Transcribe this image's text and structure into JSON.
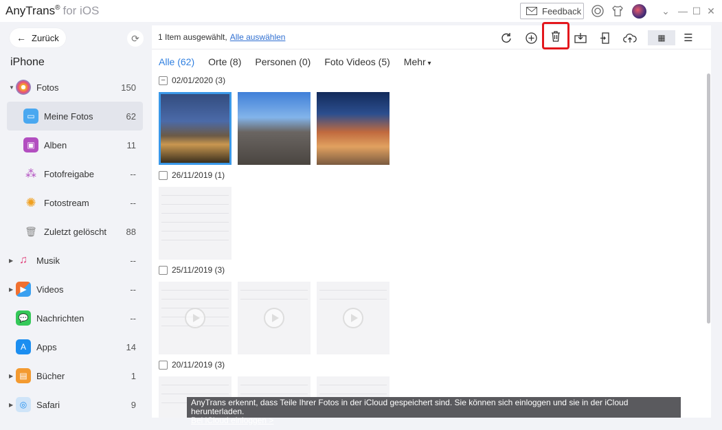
{
  "app": {
    "name": "AnyTrans",
    "reg": "®",
    "platform": "for iOS"
  },
  "titlebar": {
    "feedback_label": "Feedback"
  },
  "sidebar": {
    "back_label": "Zurück",
    "device_name": "iPhone",
    "items": [
      {
        "label": "Fotos",
        "count": "150"
      },
      {
        "label": "Meine Fotos",
        "count": "62"
      },
      {
        "label": "Alben",
        "count": "11"
      },
      {
        "label": "Fotofreigabe",
        "count": "--"
      },
      {
        "label": "Fotostream",
        "count": "--"
      },
      {
        "label": "Zuletzt gelöscht",
        "count": "88"
      },
      {
        "label": "Musik",
        "count": "--"
      },
      {
        "label": "Videos",
        "count": "--"
      },
      {
        "label": "Nachrichten",
        "count": "--"
      },
      {
        "label": "Apps",
        "count": "14"
      },
      {
        "label": "Bücher",
        "count": "1"
      },
      {
        "label": "Safari",
        "count": "9"
      }
    ]
  },
  "toolbar": {
    "selection_text": "1 Item ausgewählt,",
    "select_all_label": "Alle auswählen"
  },
  "tabs": [
    "Alle (62)",
    "Orte (8)",
    "Personen (0)",
    "Foto Videos (5)",
    "Mehr"
  ],
  "groups": [
    {
      "date": "02/01/2020 (3)"
    },
    {
      "date": "26/11/2019 (1)"
    },
    {
      "date": "25/11/2019 (3)"
    },
    {
      "date": "20/11/2019 (3)"
    }
  ],
  "toast": {
    "message": "AnyTrans erkennt, dass Teile Ihrer Fotos in der iCloud gespeichert sind. Sie können sich einloggen und sie in der iCloud herunterladen.",
    "link_label": "Bei iCloud einloggen >"
  },
  "accent_color": "#2f7fe0",
  "highlight_color": "#e3161c"
}
